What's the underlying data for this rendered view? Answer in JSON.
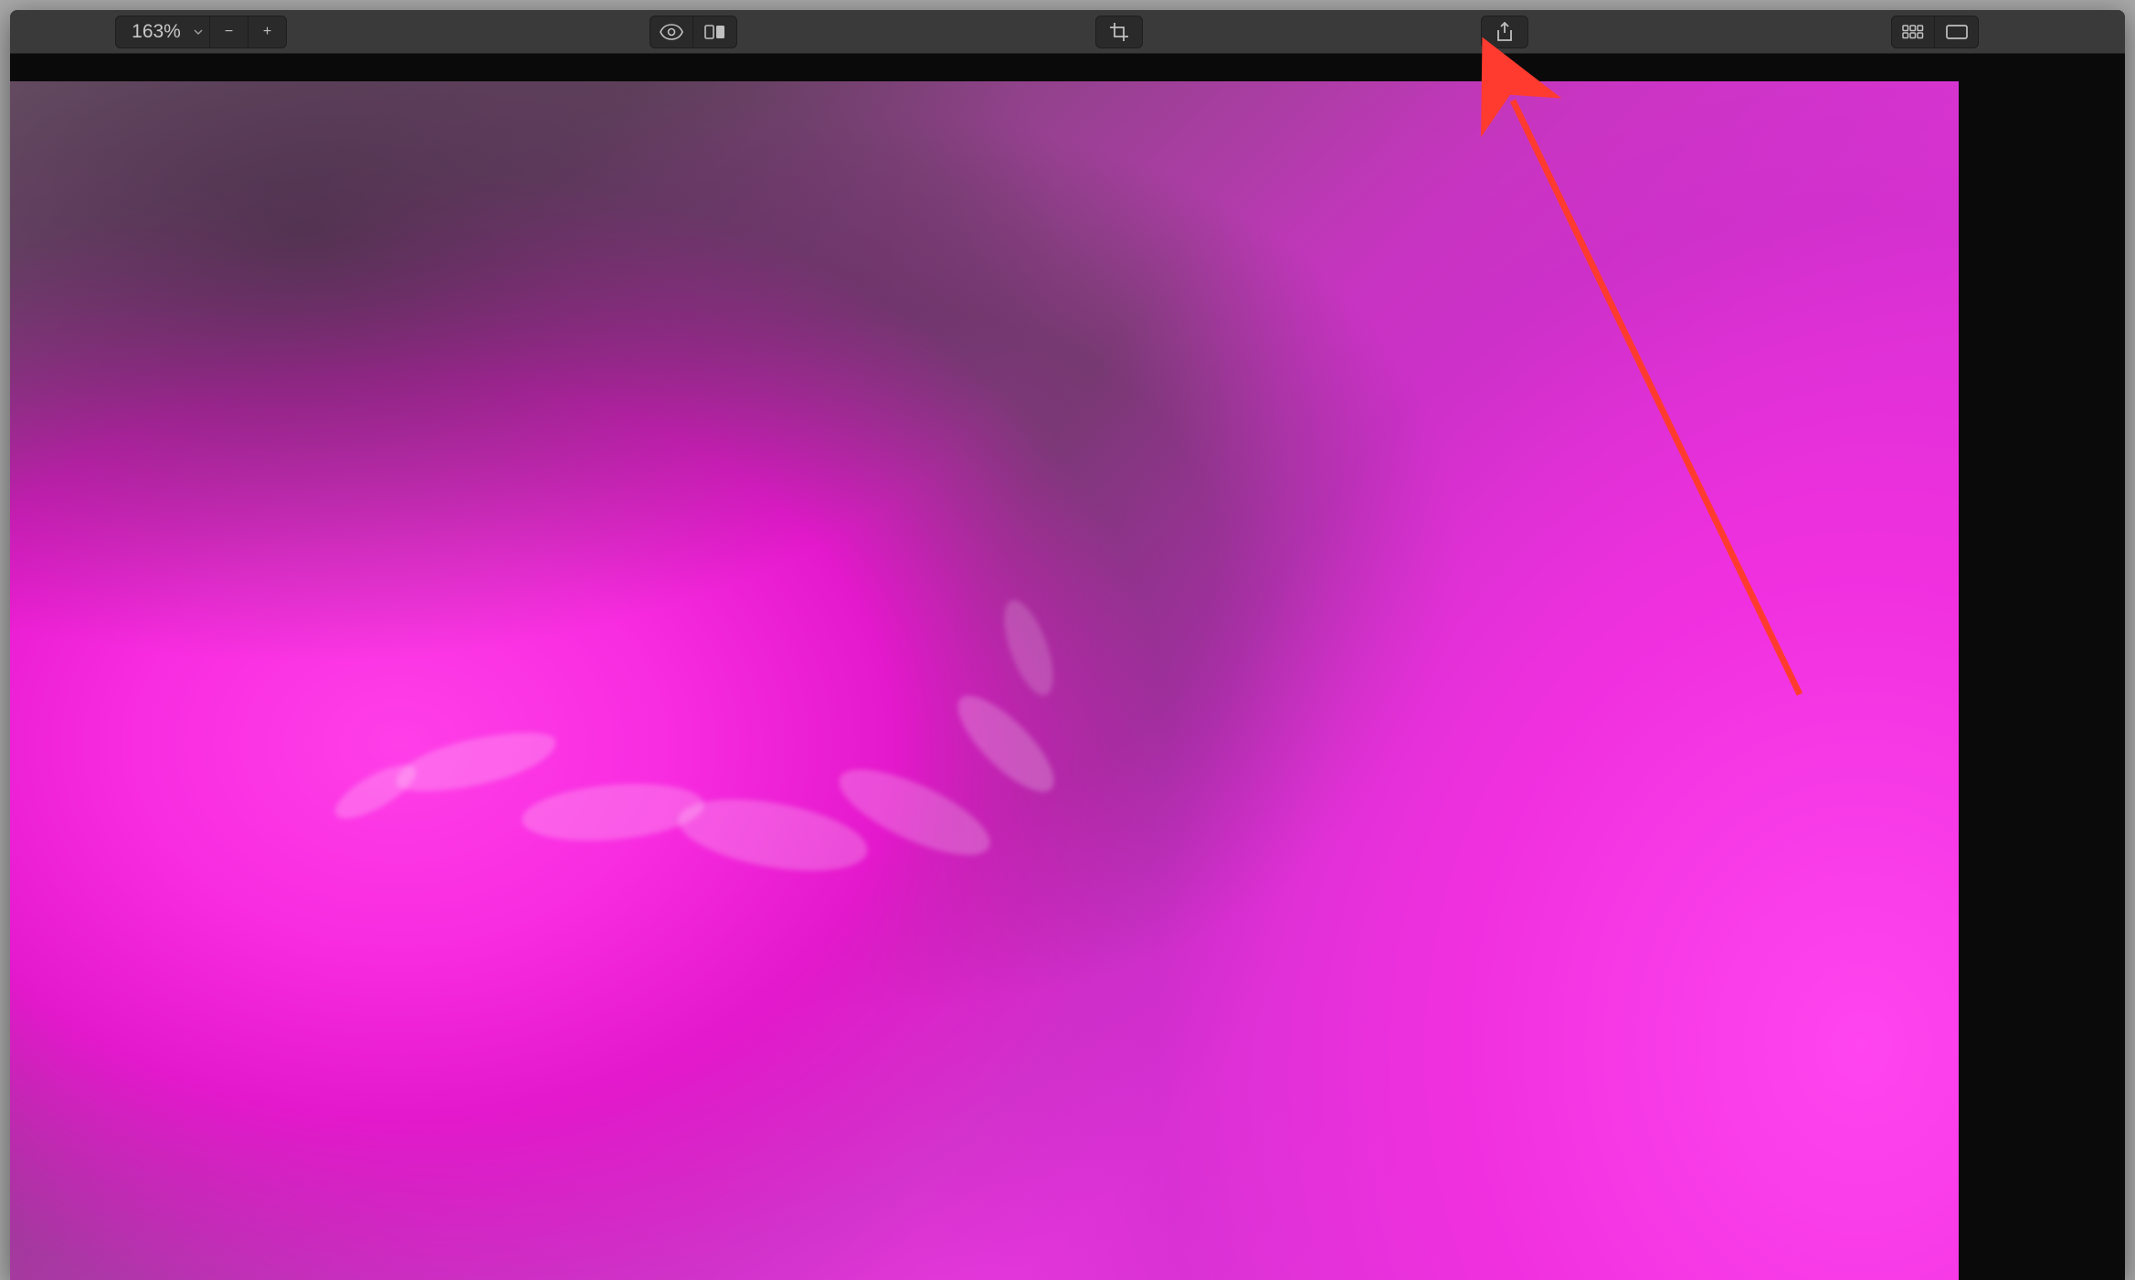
{
  "toolbar": {
    "zoom": {
      "value": "163%",
      "decrease_label": "−",
      "increase_label": "+"
    },
    "icons": {
      "eye": "eye-icon",
      "compare": "compare-icon",
      "crop": "crop-icon",
      "share": "share-icon",
      "grid": "grid-icon",
      "single": "single-view-icon",
      "chevron": "chevron-down-icon"
    }
  }
}
